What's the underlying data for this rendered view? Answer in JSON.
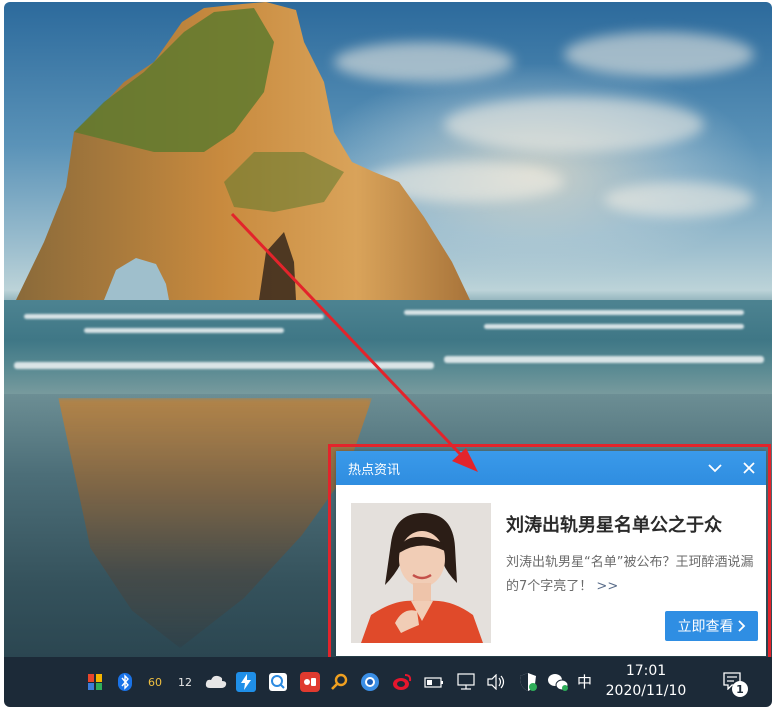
{
  "popup": {
    "title": "热点资讯",
    "headline": "刘涛出轨男星名单公之于众",
    "summary": "刘涛出轨男星“名单”被公布？王珂醉酒说漏的7个字亮了！",
    "more": ">>",
    "view_button": "立即查看",
    "accent_color": "#2f8ee3"
  },
  "taskbar": {
    "tray_values": [
      "60",
      "12"
    ],
    "ime_label": "中",
    "clock_time": "17:01",
    "clock_date": "2020/11/10",
    "notification_count": "1",
    "icons": [
      "app-icon",
      "bluetooth-icon",
      "cloud-icon",
      "thunder-icon",
      "monitor-app-icon",
      "game-app-icon",
      "search-app-icon",
      "browser-icon",
      "weibo-icon",
      "battery-icon",
      "network-icon",
      "volume-icon",
      "security-shield-icon",
      "wechat-icon",
      "notification-center-icon"
    ]
  },
  "annotation": {
    "color": "#e3242b"
  }
}
